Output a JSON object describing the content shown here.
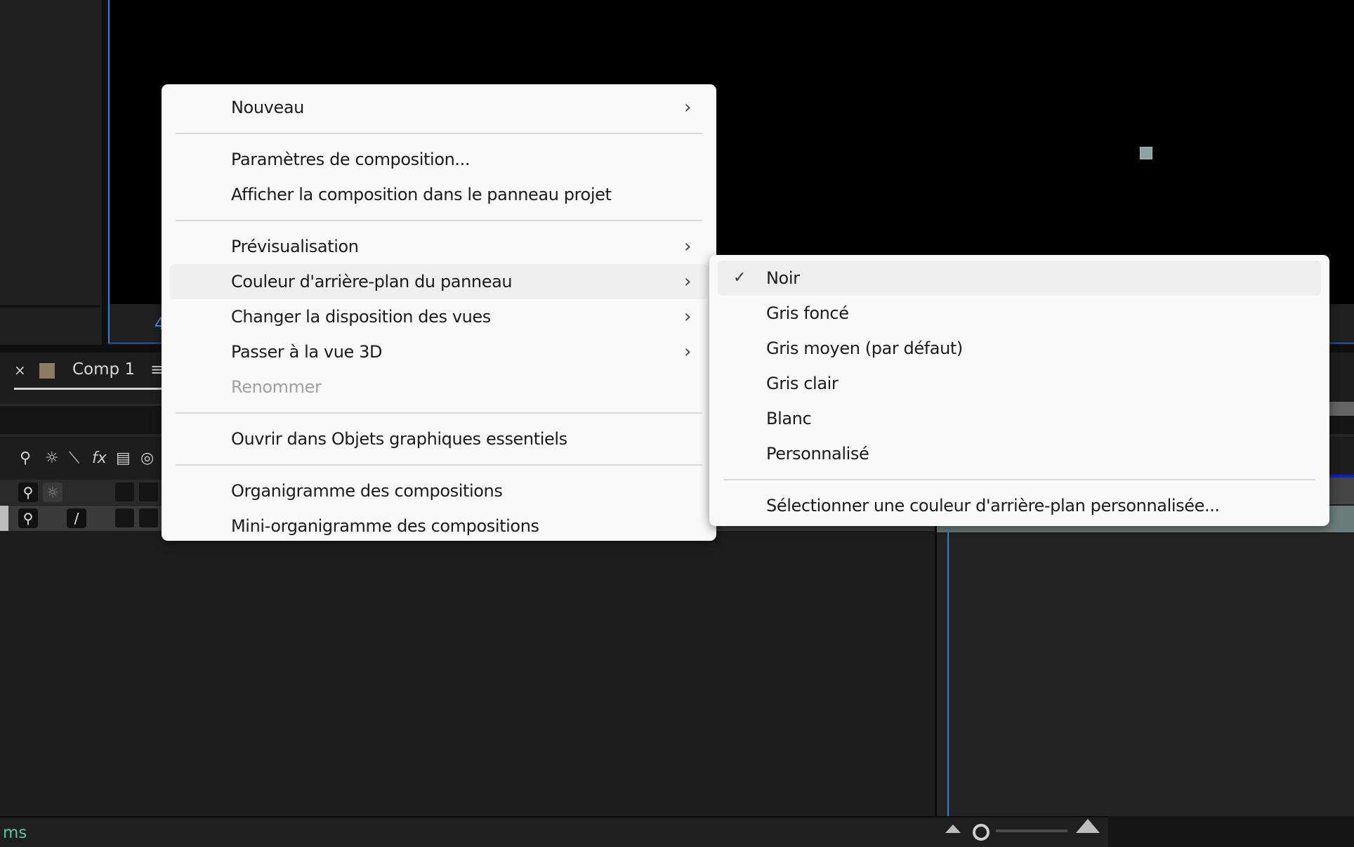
{
  "viewer": {
    "zoom_label": "4"
  },
  "timeline": {
    "tab": {
      "close_glyph": "×",
      "label": "Comp 1",
      "menu_glyph": "≡",
      "swatch_color": "#8b7b63"
    },
    "column_icons": [
      "shy-icon",
      "solo-icon",
      "quality-icon",
      "fx-icon",
      "frame-blend-icon",
      "motion-blur-icon"
    ],
    "column_glyphs": [
      "⚲",
      "☼",
      "⟍",
      "fx",
      "▤",
      "◎"
    ],
    "layers": [
      {
        "switch_glyph": "⚲",
        "switch2_glyph": "☼"
      },
      {
        "switch_glyph": "⚲",
        "switch2_glyph": "/"
      }
    ]
  },
  "status_bar": {
    "text": "ms",
    "text_color": "#54c7a0"
  },
  "context_menu": {
    "items": [
      {
        "label": "Nouveau",
        "submenu": true
      },
      {
        "separator": true
      },
      {
        "label": "Paramètres de composition..."
      },
      {
        "label": "Afficher la composition dans le panneau projet"
      },
      {
        "separator": true
      },
      {
        "label": "Prévisualisation",
        "submenu": true
      },
      {
        "label": "Couleur d'arrière-plan du panneau",
        "submenu": true,
        "highlighted": true
      },
      {
        "label": "Changer la disposition des vues",
        "submenu": true
      },
      {
        "label": "Passer à la vue 3D",
        "submenu": true
      },
      {
        "label": "Renommer",
        "disabled": true
      },
      {
        "separator": true
      },
      {
        "label": "Ouvrir dans Objets graphiques essentiels"
      },
      {
        "separator": true
      },
      {
        "label": "Organigramme des compositions"
      },
      {
        "label": "Mini-organigramme des compositions"
      }
    ],
    "chevron_glyph": "›"
  },
  "submenu": {
    "items": [
      {
        "label": "Noir",
        "checked": true,
        "highlighted": true
      },
      {
        "label": "Gris foncé"
      },
      {
        "label": "Gris moyen (par défaut)"
      },
      {
        "label": "Gris clair"
      },
      {
        "label": "Blanc"
      },
      {
        "label": "Personnalisé"
      },
      {
        "separator": true
      },
      {
        "label": "Sélectionner une couleur d'arrière-plan personnalisée..."
      }
    ],
    "check_glyph": "✓"
  },
  "colors": {
    "accent_blue": "#3a7fd5",
    "menu_bg": "#f9f9f9",
    "menu_highlight": "#efefef"
  }
}
